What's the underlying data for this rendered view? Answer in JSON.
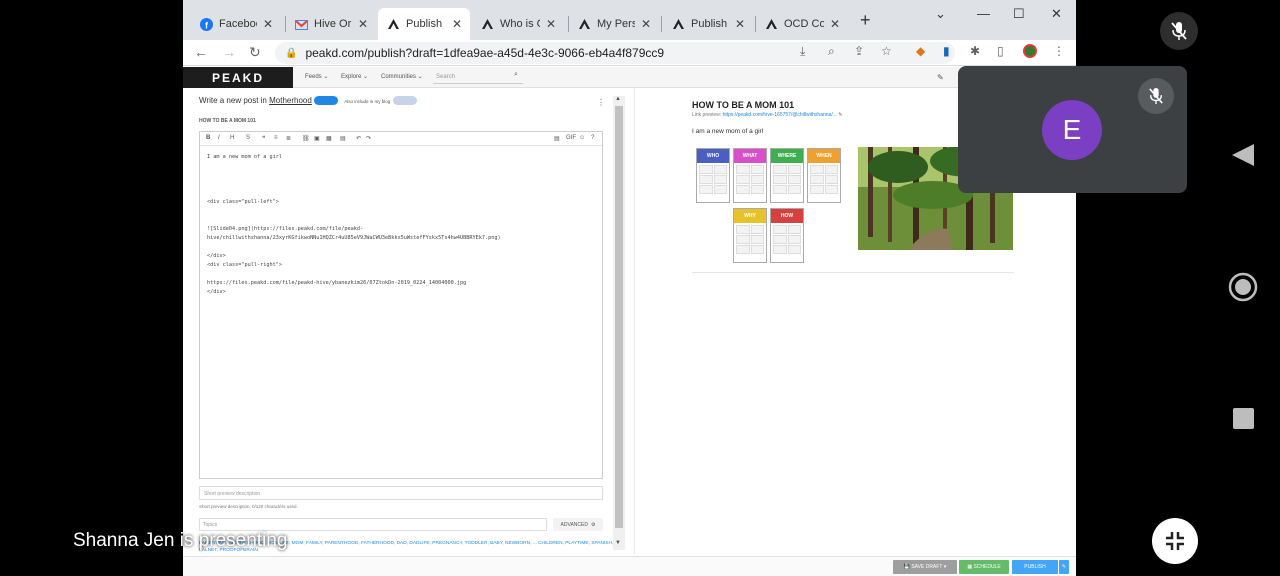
{
  "browser": {
    "tabs": [
      {
        "title": "Faceboo",
        "icon": "facebook-icon",
        "color": "#1877f2"
      },
      {
        "title": "Hive Ori",
        "icon": "gmail-icon",
        "color": "#ea4335"
      },
      {
        "title": "Publish |",
        "icon": "peakd-icon",
        "color": "#222222",
        "active": true
      },
      {
        "title": "Who is C",
        "icon": "peakd-icon",
        "color": "#222222"
      },
      {
        "title": "My Perso",
        "icon": "peakd-icon",
        "color": "#222222"
      },
      {
        "title": "Publish |",
        "icon": "peakd-icon",
        "color": "#222222"
      },
      {
        "title": "OCD Co",
        "icon": "peakd-icon",
        "color": "#222222"
      }
    ],
    "url": "peakd.com/publish?draft=1dfea9ae-a45d-4e3c-9066-eb4a4f879cc9"
  },
  "peakd": {
    "logo": "PEAKD",
    "menu": [
      "Feeds ⌄",
      "Explore ⌄",
      "Communities ⌄"
    ],
    "search_placeholder": "Search",
    "editor": {
      "heading_prefix": "Write a new post in ",
      "community": "Motherhood",
      "also_include": "Also include in my blog",
      "title": "HOW TO BE A MOM 101",
      "body": "I am a new mom of a girl\n\n\n\n\n<div class=\"pull-left\">\n\n\n![Slide04.png](https://files.peakd.com/file/peakd-\nhive/chillwithshanna/23xyrKGfikwoNNu1HQZCr4uU85eV9JWaCWU3eBkkx5uWstefFYskx5Ts4hw4UBBRYEk7.png)\n\n</div>\n<div class=\"pull-right\">\n\nhttps://files.peakd.com/file/peakd-hive/ybanezkim26/07ZtokDn-2019_0224_14004000.jpg\n</div>",
      "short_desc_placeholder": "Short preview description",
      "short_desc_note": "Short preview description: 0/120 characters used.",
      "topics_placeholder": "Topics",
      "advanced_label": "ADVANCED",
      "tags": "PARENTING, MOTHERHOOD, MOMLIFE, MOM, FAMILY, PARENTHOOD, FATHERHOOD, DAD, DADLIFE, PREGNANCY, TODDLER, BABY, NEWBORN, ... CHILDREN, PLAYTIME, SPANISH, PALNET, PROOFOFBRAIN"
    },
    "preview": {
      "title": "HOW TO BE A MOM 101",
      "link_label": "Link preview:",
      "link_url": "https://peakd.com/hive-165757/@chillwithshanna/...",
      "body": "I am a new mom of a girl",
      "cards": [
        {
          "label": "WHO",
          "color": "#4a5fc1"
        },
        {
          "label": "WHAT",
          "color": "#d94fc8"
        },
        {
          "label": "WHERE",
          "color": "#3fae4f"
        },
        {
          "label": "WHEN",
          "color": "#f0a030"
        },
        {
          "label": "WHY",
          "color": "#e8c22a"
        },
        {
          "label": "HOW",
          "color": "#d84040"
        }
      ]
    },
    "footer": {
      "save_draft": "SAVE DRAFT",
      "schedule": "SCHEDULE",
      "publish": "PUBLISH"
    }
  },
  "meet": {
    "participant_initial": "E",
    "avatar_color": "#7b3fc4",
    "presenting_text": "Shanna Jen is presenting"
  }
}
